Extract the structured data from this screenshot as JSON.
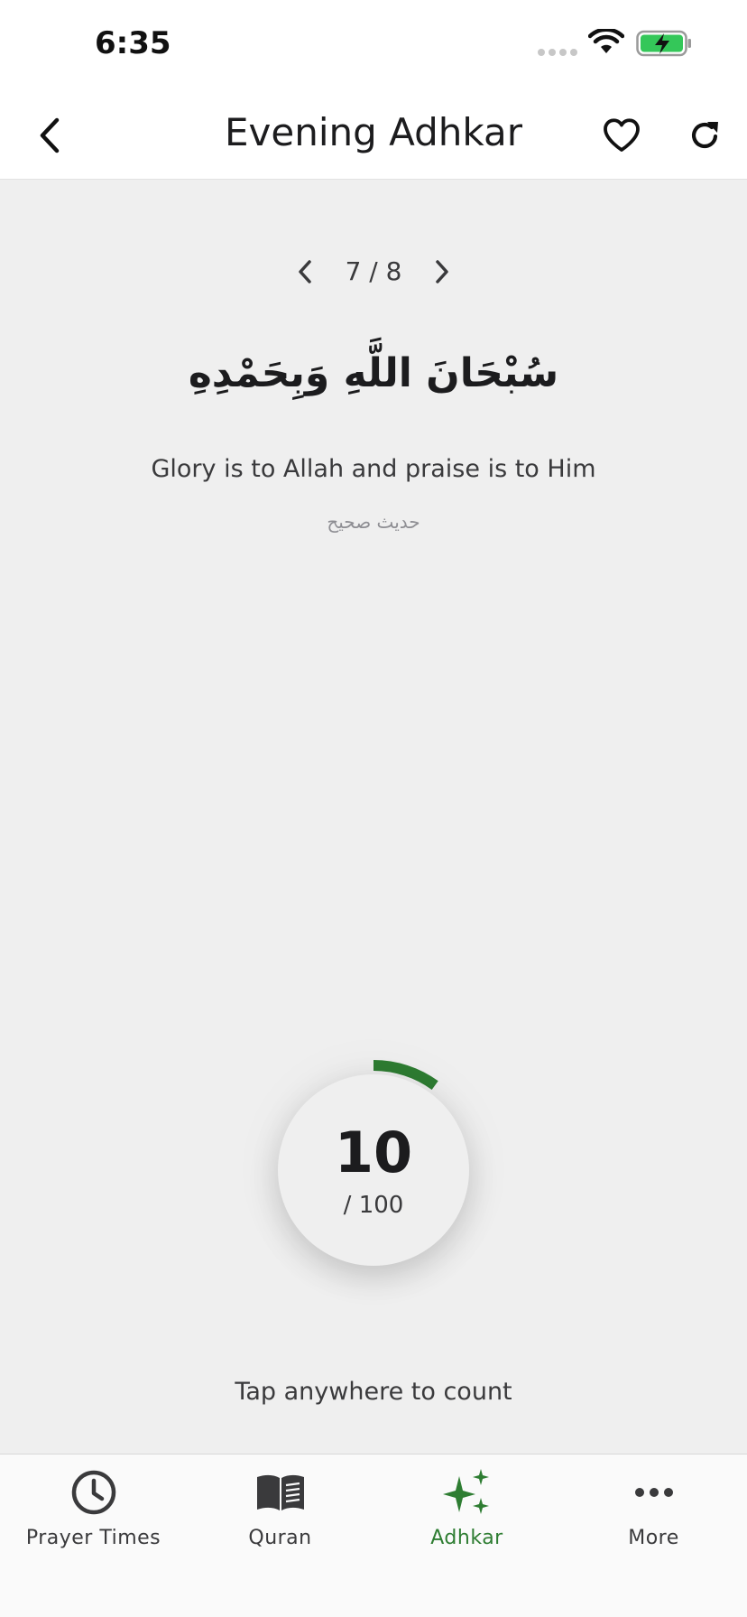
{
  "status_bar": {
    "time": "6:35"
  },
  "header": {
    "title": "Evening Adhkar"
  },
  "pager": {
    "text": "7 / 8"
  },
  "dhikr": {
    "arabic": "سُبْحَانَ اللَّهِ وَبِحَمْدِهِ",
    "translation": "Glory is to Allah and praise is to Him",
    "source": "حديث صحيح"
  },
  "counter": {
    "value": "10",
    "total": "/ 100",
    "progress": 0.1
  },
  "hint": "Tap anywhere to count",
  "tabs": [
    {
      "label": "Prayer Times",
      "icon": "clock-icon"
    },
    {
      "label": "Quran",
      "icon": "book-icon"
    },
    {
      "label": "Adhkar",
      "icon": "sparkles-icon",
      "active": true
    },
    {
      "label": "More",
      "icon": "more-dots-icon"
    }
  ],
  "colors": {
    "accent": "#2e7d32",
    "battery": "#34c759",
    "background": "#efefef"
  }
}
